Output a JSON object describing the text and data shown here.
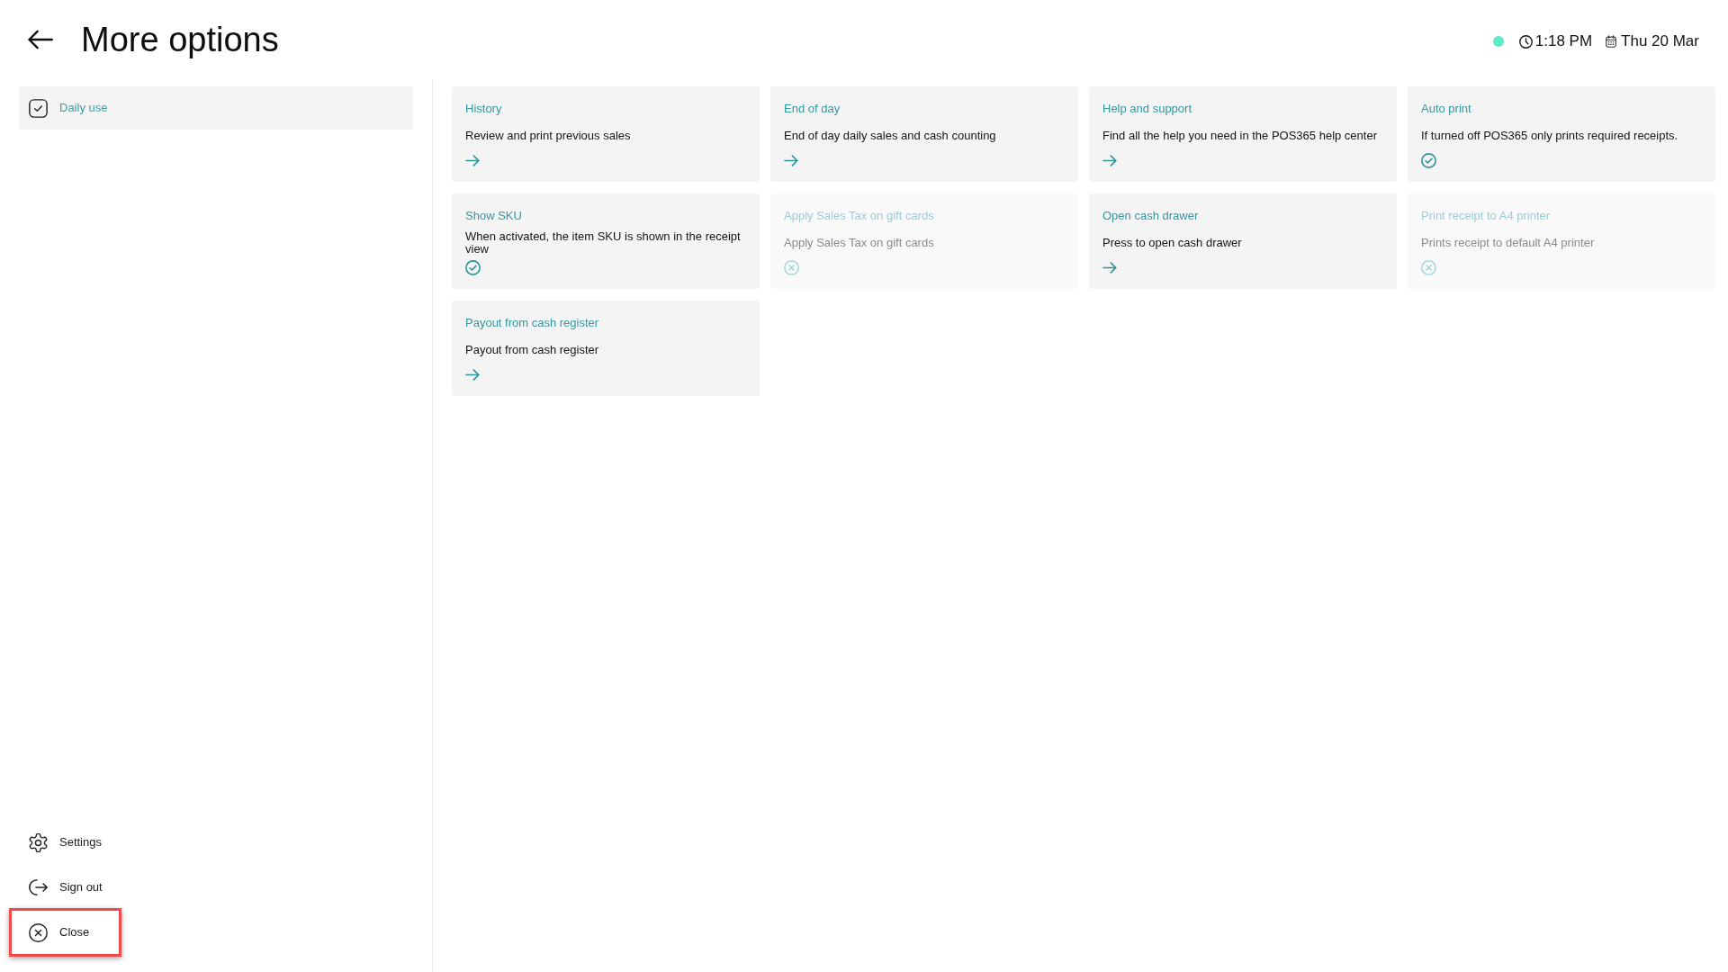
{
  "header": {
    "title": "More options",
    "online": true,
    "time": "1:18 PM",
    "date": "Thu 20 Mar"
  },
  "sidebar": {
    "sections": [
      {
        "label": "Daily use",
        "selected": true
      }
    ],
    "footer_items": [
      {
        "label": "Settings",
        "kind": "settings",
        "highlighted": false
      },
      {
        "label": "Sign out",
        "kind": "sign_out",
        "highlighted": false
      },
      {
        "label": "Close",
        "kind": "close",
        "highlighted": true
      }
    ]
  },
  "options": [
    {
      "title": "History",
      "description": "Review and print previous sales",
      "kind": "link"
    },
    {
      "title": "End of day",
      "description": "End of day daily sales and cash counting",
      "kind": "link"
    },
    {
      "title": "Help and support",
      "description": "Find all the help you need in the POS365 help center",
      "kind": "link"
    },
    {
      "title": "Auto print",
      "description": "If turned off POS365 only prints required receipts.",
      "kind": "toggle",
      "on": true
    },
    {
      "title": "Show SKU",
      "description": "When activated, the item SKU is shown in the receipt view",
      "kind": "toggle",
      "on": true
    },
    {
      "title": "Apply Sales Tax on gift cards",
      "description": "Apply Sales Tax on gift cards",
      "kind": "toggle",
      "on": false
    },
    {
      "title": "Open cash drawer",
      "description": "Press to open cash drawer",
      "kind": "link"
    },
    {
      "title": "Print receipt to A4 printer",
      "description": "Prints receipt to default A4 printer",
      "kind": "toggle",
      "on": false
    },
    {
      "title": "Payout from cash register",
      "description": "Payout from cash register",
      "kind": "link"
    }
  ]
}
